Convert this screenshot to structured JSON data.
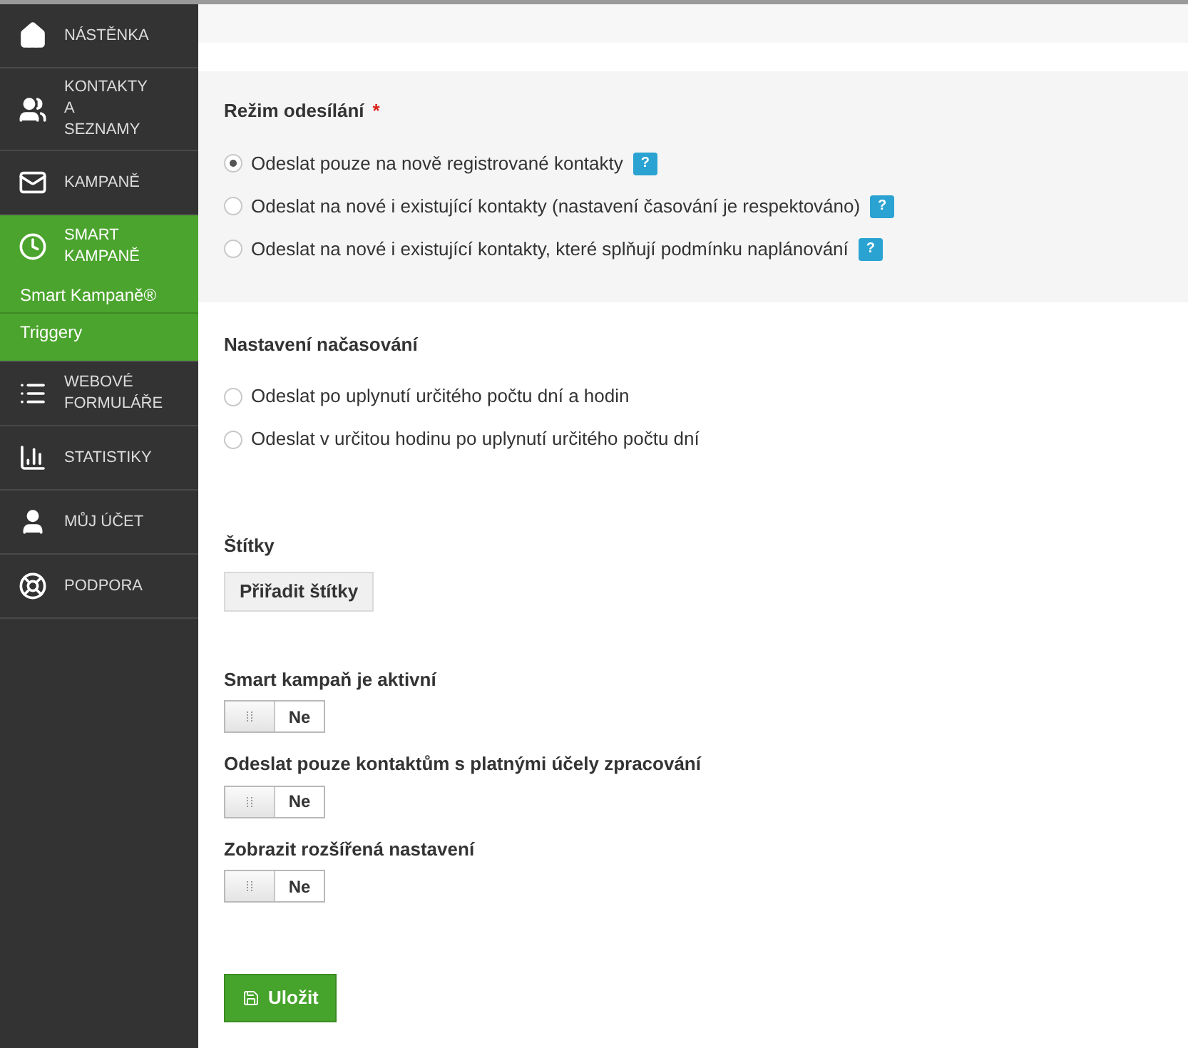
{
  "sidebar": {
    "items": [
      {
        "label": "NÁSTĚNKA",
        "selected": false
      },
      {
        "label": "KONTAKTY A SEZNAMY",
        "selected": false
      },
      {
        "label": "KAMPANĚ",
        "selected": false
      },
      {
        "label": "SMART KAMPANĚ",
        "selected": true,
        "children": [
          {
            "label": "Smart Kampaně®"
          },
          {
            "label": "Triggery"
          }
        ]
      },
      {
        "label": "WEBOVÉ FORMULÁŘE",
        "selected": false
      },
      {
        "label": "STATISTIKY",
        "selected": false
      },
      {
        "label": "MŮJ ÚČET",
        "selected": false
      },
      {
        "label": "PODPORA",
        "selected": false
      }
    ]
  },
  "sending_mode": {
    "title": "Režim odesílání",
    "required_mark": "*",
    "help_mark": "?",
    "options": [
      {
        "label": "Odeslat pouze na nově registrované kontakty",
        "selected": true,
        "help": true
      },
      {
        "label": "Odeslat na nové i existující kontakty (nastavení časování je respektováno)",
        "selected": false,
        "help": true
      },
      {
        "label": "Odeslat na nové i existující kontakty, které splňují podmínku naplánování",
        "selected": false,
        "help": true
      }
    ]
  },
  "timing": {
    "title": "Nastavení načasování",
    "options": [
      {
        "label": "Odeslat po uplynutí určitého počtu dní a hodin",
        "selected": false
      },
      {
        "label": "Odeslat v určitou hodinu po uplynutí určitého počtu dní",
        "selected": false
      }
    ]
  },
  "tags": {
    "title": "Štítky",
    "button": "Přiřadit štítky"
  },
  "toggles": [
    {
      "label": "Smart kampaň je aktivní",
      "on": false,
      "value_text": "Ne"
    },
    {
      "label": "Odeslat pouze kontaktům s platnými účely zpracování",
      "on": false,
      "value_text": "Ne"
    },
    {
      "label": "Zobrazit rozšířená nastavení",
      "on": false,
      "value_text": "Ne"
    }
  ],
  "save_button": "Uložit"
}
